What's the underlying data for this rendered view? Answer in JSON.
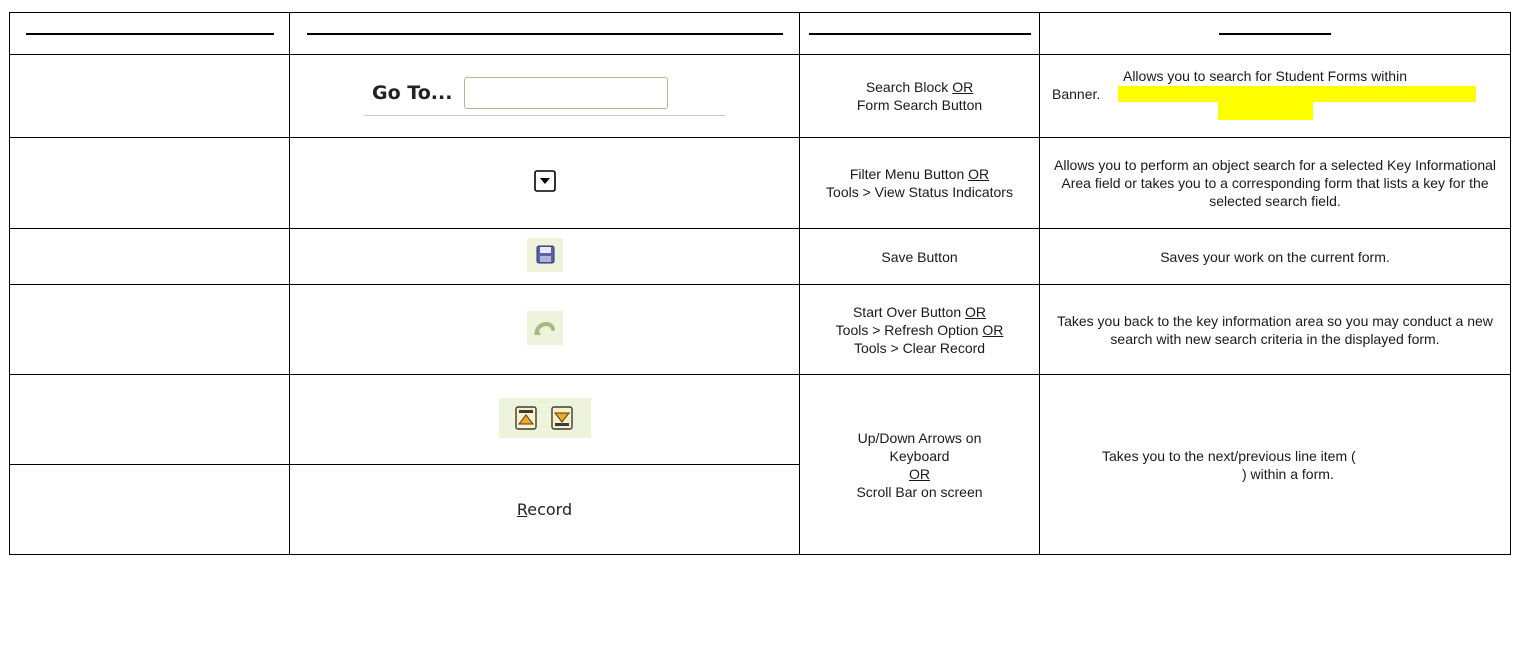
{
  "rows": [
    {
      "col3": [
        "Search Block ",
        "OR",
        "Form Search Button"
      ],
      "col4": "Allows you to search for Student Forms within Banner.",
      "goto_label": "Go To...",
      "icon": "go-to-search-field"
    },
    {
      "col3_l1": "Filter Menu Button ",
      "col3_or": "OR",
      "col3_l2": "Tools > View Status Indicators",
      "col4": "Allows you to perform an object search for a selected Key Informational Area field or takes you to a corresponding form that lists a key for the selected search field.",
      "icon": "filter-dropdown-icon"
    },
    {
      "col3": "Save Button",
      "col4": "Saves your work on the current form.",
      "icon": "save-floppy-icon"
    },
    {
      "col3_l1": "Start Over Button ",
      "col3_or1": "OR",
      "col3_l2": "Tools > Refresh Option ",
      "col3_or2": "OR",
      "col3_l3": "Tools > Clear Record",
      "col4": "Takes you back to the key information area so you may conduct a new search with new search criteria in the displayed form.",
      "icon": "start-over-undo-icon"
    },
    {
      "col3_l1": "Up/Down Arrows on Keyboard",
      "col3_or": "OR",
      "col3_l2": "Scroll Bar on screen",
      "col4_a": "Takes you to the next/previous line item (",
      "col4_b": ") within a form.",
      "icon": "record-up-down-icons",
      "record_label_rest": "ecord",
      "record_label_underlined": "R"
    }
  ]
}
